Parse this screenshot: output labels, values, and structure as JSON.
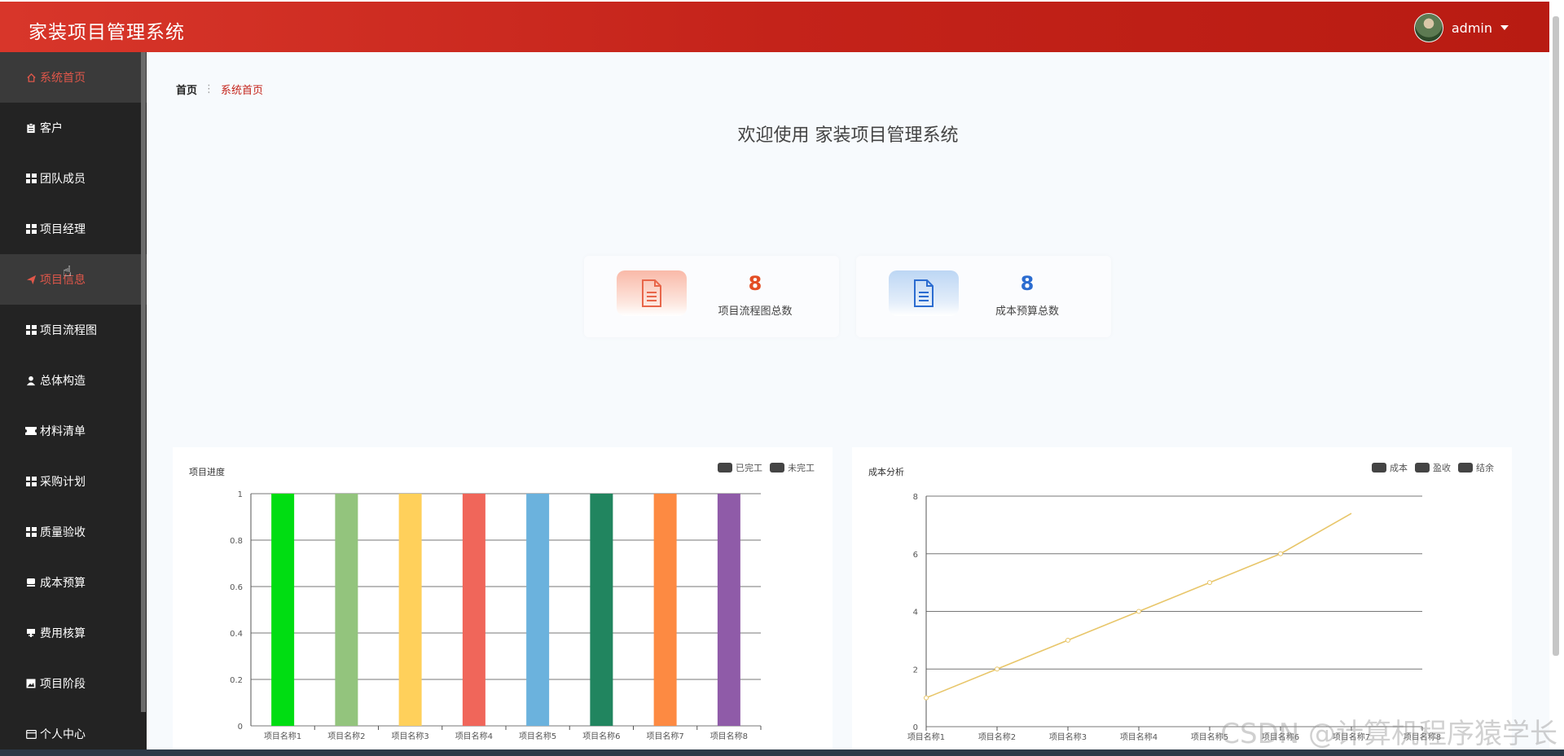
{
  "app": {
    "title": "家装项目管理系统"
  },
  "user": {
    "name": "admin"
  },
  "sidebar": {
    "items": [
      {
        "label": "系统首页",
        "icon": "home-icon"
      },
      {
        "label": "客户",
        "icon": "clipboard-icon"
      },
      {
        "label": "团队成员",
        "icon": "grid-icon"
      },
      {
        "label": "项目经理",
        "icon": "grid-icon"
      },
      {
        "label": "项目信息",
        "icon": "send-icon"
      },
      {
        "label": "项目流程图",
        "icon": "grid-icon"
      },
      {
        "label": "总体构造",
        "icon": "user-icon"
      },
      {
        "label": "材料清单",
        "icon": "ticket-icon"
      },
      {
        "label": "采购计划",
        "icon": "grid-icon"
      },
      {
        "label": "质量验收",
        "icon": "grid-icon"
      },
      {
        "label": "成本预算",
        "icon": "cash-icon"
      },
      {
        "label": "费用核算",
        "icon": "yen-icon"
      },
      {
        "label": "项目阶段",
        "icon": "image-icon"
      },
      {
        "label": "个人中心",
        "icon": "id-card-icon"
      }
    ]
  },
  "breadcrumb": {
    "home": "首页",
    "separator": "⋮",
    "current": "系统首页"
  },
  "welcome": "欢迎使用 家装项目管理系统",
  "stats": [
    {
      "value": "8",
      "label": "项目流程图总数",
      "icon": "document-icon",
      "color": "#e34d24"
    },
    {
      "value": "8",
      "label": "成本预算总数",
      "icon": "document-icon",
      "color": "#2b6cd0"
    }
  ],
  "chart_data": [
    {
      "type": "bar",
      "title": "项目进度",
      "legend": [
        "已完工",
        "未完工"
      ],
      "legend_position": "top-right",
      "categories": [
        "项目名称1",
        "项目名称2",
        "项目名称3",
        "项目名称4",
        "项目名称5",
        "项目名称6",
        "项目名称7",
        "项目名称8"
      ],
      "values": [
        1,
        1,
        1,
        1,
        1,
        1,
        1,
        1
      ],
      "colors": [
        "#00dd12",
        "#93c47d",
        "#ffd05b",
        "#f0665a",
        "#6bb2dd",
        "#21855f",
        "#fd8a42",
        "#8f5ba8"
      ],
      "yticks": [
        "0",
        "0.2",
        "0.4",
        "0.6",
        "0.8",
        "1"
      ],
      "ylim": [
        0,
        1
      ],
      "grid": true
    },
    {
      "type": "line",
      "title": "成本分析",
      "legend": [
        "成本",
        "盈收",
        "结余"
      ],
      "legend_position": "top-right",
      "categories": [
        "项目名称1",
        "项目名称2",
        "项目名称3",
        "项目名称4",
        "项目名称5",
        "项目名称6",
        "项目名称7",
        "项目名称8"
      ],
      "values": [
        1,
        2,
        3,
        4,
        5,
        6,
        7.4
      ],
      "line_color": "#e8c66a",
      "yticks": [
        "0",
        "2",
        "4",
        "6",
        "8"
      ],
      "ylim": [
        0,
        8
      ],
      "grid": true
    }
  ],
  "watermark": "CSDN @计算机程序猿学长"
}
